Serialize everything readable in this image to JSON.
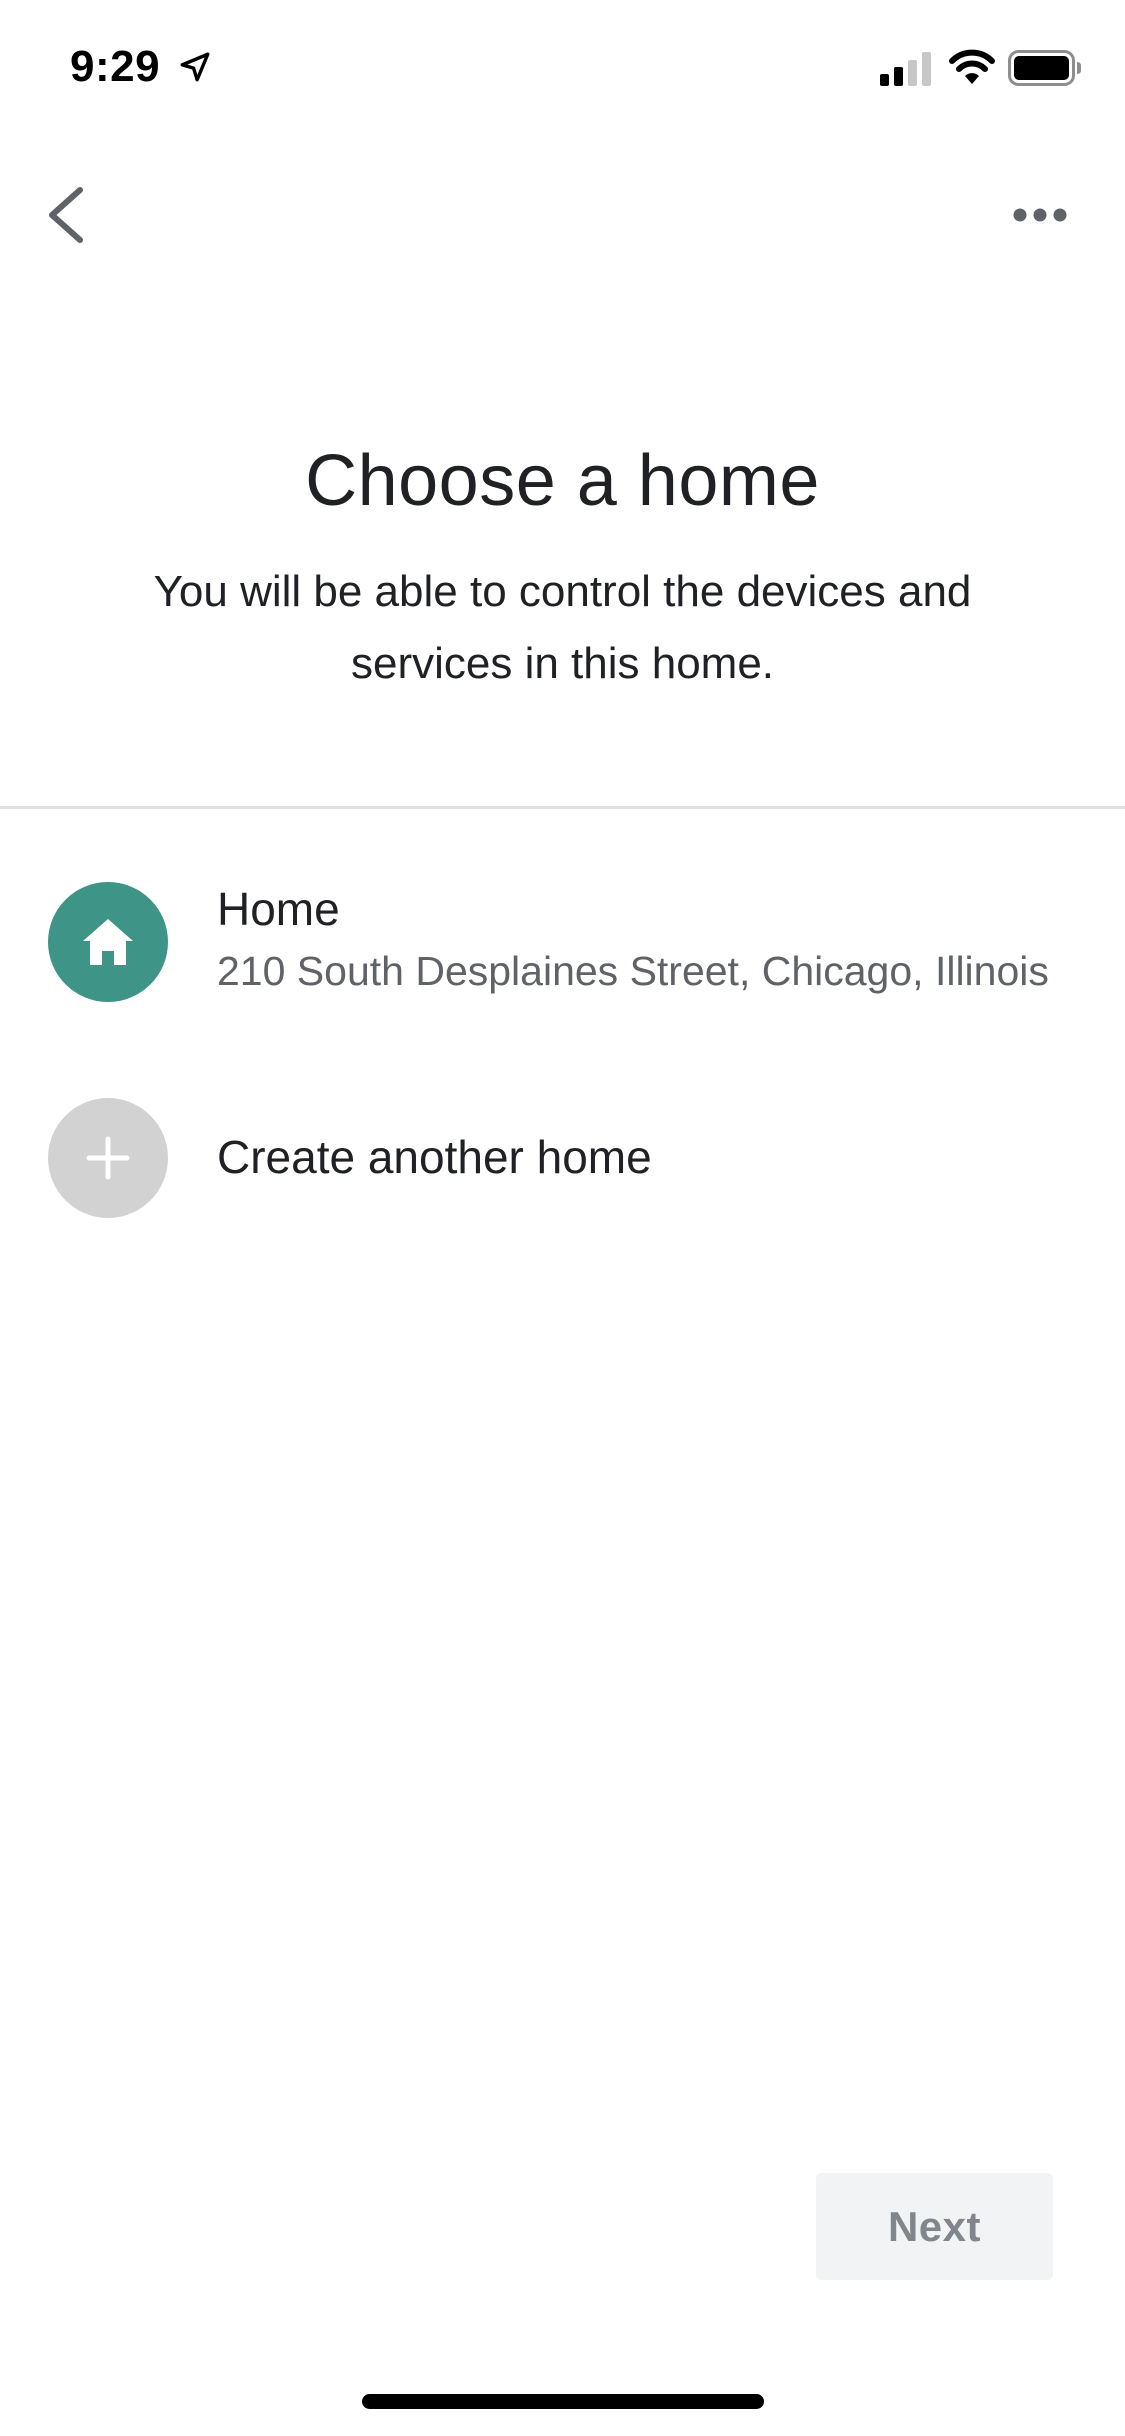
{
  "status_bar": {
    "time": "9:29",
    "icons": [
      "location-arrow-icon",
      "cellular-signal-icon",
      "wifi-icon",
      "battery-icon"
    ]
  },
  "app_bar": {
    "back_icon": "chevron-left-icon",
    "more_icon": "more-horizontal-icon"
  },
  "header": {
    "title": "Choose a home",
    "subtitle": "You will be able to control the devices and services in this home."
  },
  "homes": [
    {
      "name": "Home",
      "address": "210 South Desplaines Street, Chicago, Illinois",
      "icon": "house-icon",
      "avatar_color": "#3e9486"
    }
  ],
  "create_home": {
    "label": "Create another home",
    "icon": "plus-icon",
    "avatar_color": "#d2d2d2"
  },
  "footer": {
    "next_label": "Next",
    "next_enabled": false
  },
  "colors": {
    "accent": "#3e9486",
    "disabled_button_bg": "#f1f3f4",
    "disabled_button_text": "#80868b",
    "divider": "#e0e0e0"
  }
}
